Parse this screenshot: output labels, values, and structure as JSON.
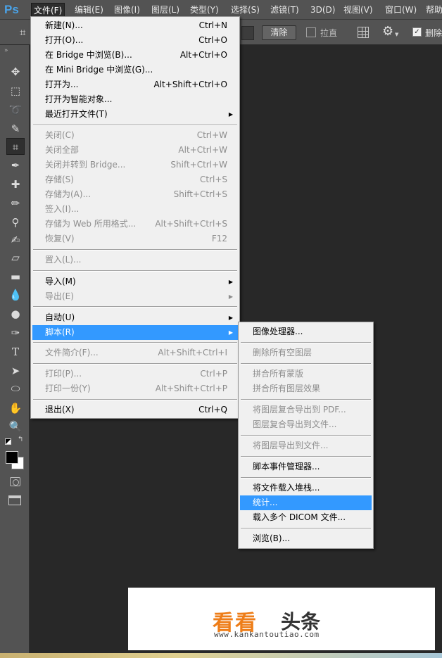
{
  "app": {
    "logo": "Ps"
  },
  "menubar": {
    "items": [
      {
        "label": "文件(F)"
      },
      {
        "label": "编辑(E)"
      },
      {
        "label": "图像(I)"
      },
      {
        "label": "图层(L)"
      },
      {
        "label": "类型(Y)"
      },
      {
        "label": "选择(S)"
      },
      {
        "label": "滤镜(T)"
      },
      {
        "label": "3D(D)"
      },
      {
        "label": "视图(V)"
      },
      {
        "label": "窗口(W)"
      },
      {
        "label": "帮助"
      }
    ]
  },
  "options_bar": {
    "clear_label": "清除",
    "straighten_label": "拉直",
    "delete_label": "删除",
    "delete_checked": true
  },
  "toolbar": {
    "tools": [
      "move-tool",
      "marquee-tool",
      "lasso-tool",
      "quick-selection-tool",
      "crop-tool",
      "eyedropper-tool",
      "healing-brush-tool",
      "brush-tool",
      "clone-stamp-tool",
      "history-brush-tool",
      "eraser-tool",
      "gradient-tool",
      "blur-tool",
      "dodge-tool",
      "pen-tool",
      "type-tool",
      "path-selection-tool",
      "shape-tool",
      "hand-tool",
      "zoom-tool"
    ],
    "selected_tool": "crop-tool",
    "foreground_color": "#000000",
    "background_color": "#ffffff"
  },
  "file_menu": {
    "items": [
      {
        "label": "新建(N)...",
        "shortcut": "Ctrl+N"
      },
      {
        "label": "打开(O)...",
        "shortcut": "Ctrl+O"
      },
      {
        "label": "在 Bridge 中浏览(B)...",
        "shortcut": "Alt+Ctrl+O"
      },
      {
        "label": "在 Mini Bridge 中浏览(G)...",
        "shortcut": ""
      },
      {
        "label": "打开为...",
        "shortcut": "Alt+Shift+Ctrl+O"
      },
      {
        "label": "打开为智能对象...",
        "shortcut": ""
      },
      {
        "label": "最近打开文件(T)",
        "shortcut": ""
      },
      {
        "label": "关闭(C)",
        "shortcut": "Ctrl+W"
      },
      {
        "label": "关闭全部",
        "shortcut": "Alt+Ctrl+W"
      },
      {
        "label": "关闭并转到 Bridge...",
        "shortcut": "Shift+Ctrl+W"
      },
      {
        "label": "存储(S)",
        "shortcut": "Ctrl+S"
      },
      {
        "label": "存储为(A)...",
        "shortcut": "Shift+Ctrl+S"
      },
      {
        "label": "签入(I)...",
        "shortcut": ""
      },
      {
        "label": "存储为 Web 所用格式...",
        "shortcut": "Alt+Shift+Ctrl+S"
      },
      {
        "label": "恢复(V)",
        "shortcut": "F12"
      },
      {
        "label": "置入(L)...",
        "shortcut": ""
      },
      {
        "label": "导入(M)",
        "shortcut": ""
      },
      {
        "label": "导出(E)",
        "shortcut": ""
      },
      {
        "label": "自动(U)",
        "shortcut": ""
      },
      {
        "label": "脚本(R)",
        "shortcut": ""
      },
      {
        "label": "文件简介(F)...",
        "shortcut": "Alt+Shift+Ctrl+I"
      },
      {
        "label": "打印(P)...",
        "shortcut": "Ctrl+P"
      },
      {
        "label": "打印一份(Y)",
        "shortcut": "Alt+Shift+Ctrl+P"
      },
      {
        "label": "退出(X)",
        "shortcut": "Ctrl+Q"
      }
    ]
  },
  "script_menu": {
    "items": [
      {
        "label": "图像处理器..."
      },
      {
        "label": "删除所有空图层"
      },
      {
        "label": "拼合所有蒙版"
      },
      {
        "label": "拼合所有图层效果"
      },
      {
        "label": "将图层复合导出到 PDF..."
      },
      {
        "label": "图层复合导出到文件..."
      },
      {
        "label": "将图层导出到文件..."
      },
      {
        "label": "脚本事件管理器..."
      },
      {
        "label": "将文件载入堆栈..."
      },
      {
        "label": "统计..."
      },
      {
        "label": "载入多个 DICOM 文件..."
      },
      {
        "label": "浏览(B)..."
      }
    ]
  },
  "watermark": {
    "brand_kan": "看看",
    "brand_toutiao": "头条",
    "url": "www.kankantoutiao.com"
  }
}
